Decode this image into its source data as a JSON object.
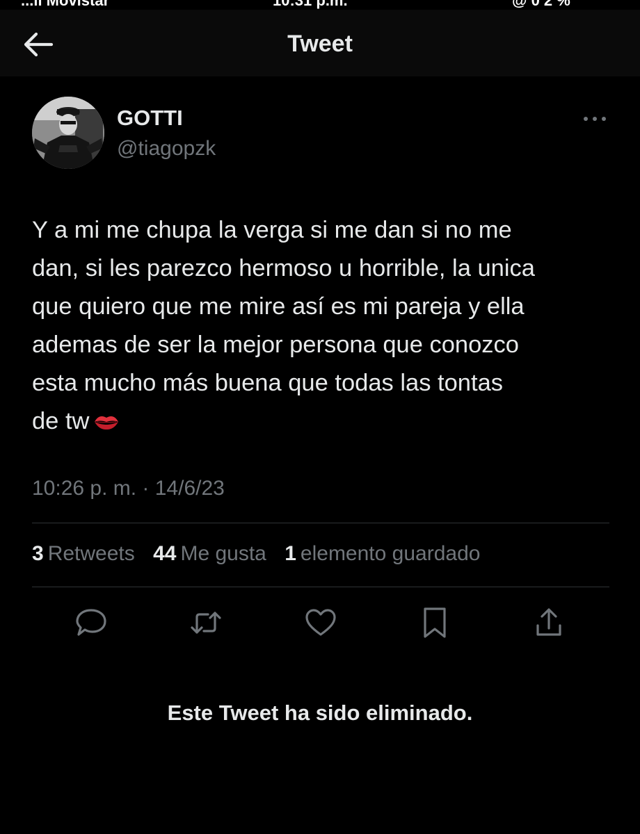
{
  "status_bar": {
    "left_partial": "...ll Movistar",
    "time_partial": "10:31 p.m.",
    "right_partial": "@ 0 2 %"
  },
  "header": {
    "title": "Tweet",
    "back_icon": "arrow-left-icon"
  },
  "tweet": {
    "author": {
      "display_name": "GOTTI",
      "handle": "@tiagopzk"
    },
    "more_icon": "more-horizontal-icon",
    "text": "Y a mi me chupa la verga si me dan si no me\ndan, si les parezco hermoso u horrible, la unica\nque quiero que me mire así es mi pareja y ella\nademas de ser la mejor persona que conozco\nesta mucho más buena que todas las tontas\nde tw",
    "emoji": "💋",
    "timestamp": "10:26 p. m. · 14/6/23",
    "stats": {
      "retweets_count": "3",
      "retweets_label": "Retweets",
      "likes_count": "44",
      "likes_label": "Me gusta",
      "bookmarks_count": "1",
      "bookmarks_label": "elemento guardado"
    },
    "actions": [
      "reply-icon",
      "retweet-icon",
      "like-icon",
      "bookmark-icon",
      "share-icon"
    ]
  },
  "deleted_message": "Este Tweet ha sido eliminado.",
  "colors": {
    "background": "#000000",
    "text_primary": "#e7e9ea",
    "text_secondary": "#71767b",
    "divider": "#2f3336"
  }
}
